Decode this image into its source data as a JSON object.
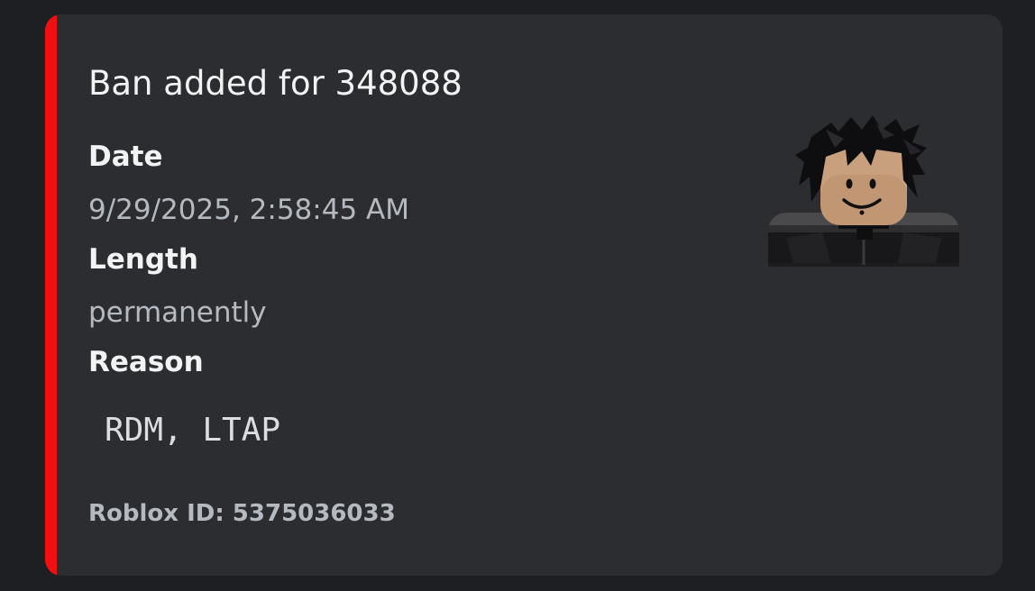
{
  "embed": {
    "accent_color": "#f20f0f",
    "title": "Ban added for 348088",
    "fields": [
      {
        "name": "Date",
        "value": "9/29/2025, 2:58:45 AM"
      },
      {
        "name": "Length",
        "value": "permanently"
      },
      {
        "name": "Reason",
        "value": "RDM, LTAP"
      }
    ],
    "footer": "Roblox ID: 5375036033",
    "thumbnail_icon": "roblox-avatar-headshot"
  }
}
